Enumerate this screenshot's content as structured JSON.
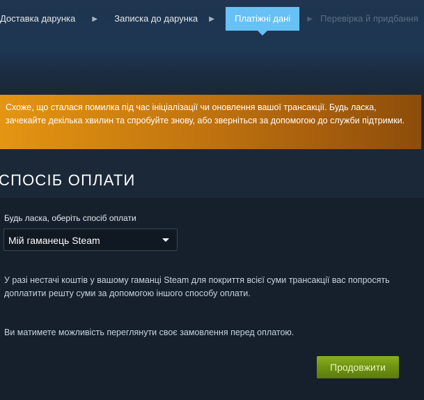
{
  "steps": [
    {
      "label": "Доставка дарунка"
    },
    {
      "label": "Записка до дарунка"
    },
    {
      "label": "Платіжні дані"
    },
    {
      "label": "Перевірка й придбання"
    }
  ],
  "error": {
    "message": "Схоже, що сталася помилка під час ініціалізації чи оновлення вашої трансакції. Будь ласка, зачекайте декілька хвилин та спробуйте знову, або зверніться за допомогою до служби підтримки."
  },
  "payment": {
    "title": "СПОСІБ ОПЛАТИ",
    "select_label": "Будь ласка, оберіть спосіб оплати",
    "selected_method": "Мій гаманець Steam",
    "wallet_note": "У разі нестачі коштів у вашому гаманці Steam для покриття всієї суми трансакції вас попросять доплатити решту суми за допомогою іншого способу оплати.",
    "review_note": "Ви матимете можливість переглянути своє замовлення перед оплатою.",
    "continue_label": "Продовжити"
  },
  "icons": {
    "step_separator": "chevron-right-icon",
    "dropdown": "caret-down-icon"
  },
  "colors": {
    "background": "#1b2838",
    "active_step": "#67c1f5",
    "error_start": "#e49512",
    "error_end": "#8c4d0a",
    "continue_button": "#6b8f11"
  }
}
